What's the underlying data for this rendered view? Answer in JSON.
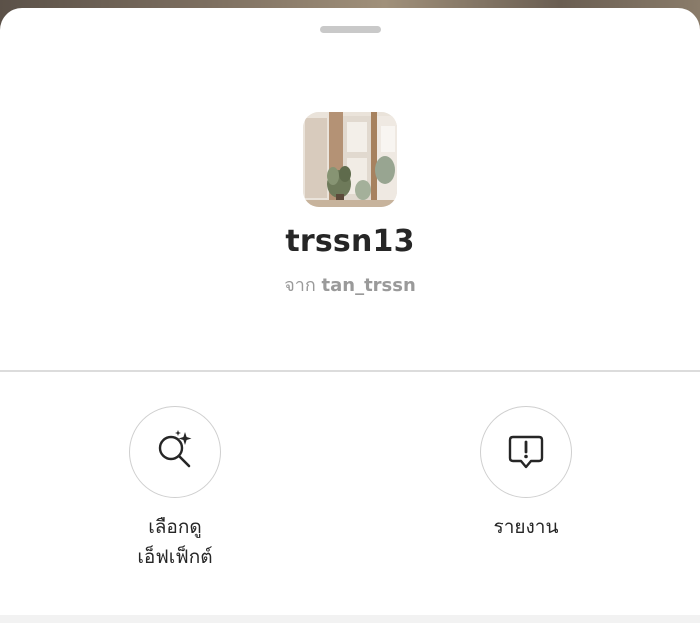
{
  "sheet": {
    "effect_name": "trssn13",
    "byline_prefix": "จาก",
    "byline_author": "tan_trssn"
  },
  "actions": [
    {
      "label": "เลือกดู\nเอ็ฟเฟ็กต์",
      "icon": "search-sparkle-icon"
    },
    {
      "label": "รายงาน",
      "icon": "report-icon"
    }
  ],
  "colors": {
    "text_primary": "#262626",
    "text_secondary": "#9a9a9a",
    "divider": "#dcdcdc",
    "circle_border": "#cfcfcf",
    "handle": "#c9c9c9"
  }
}
